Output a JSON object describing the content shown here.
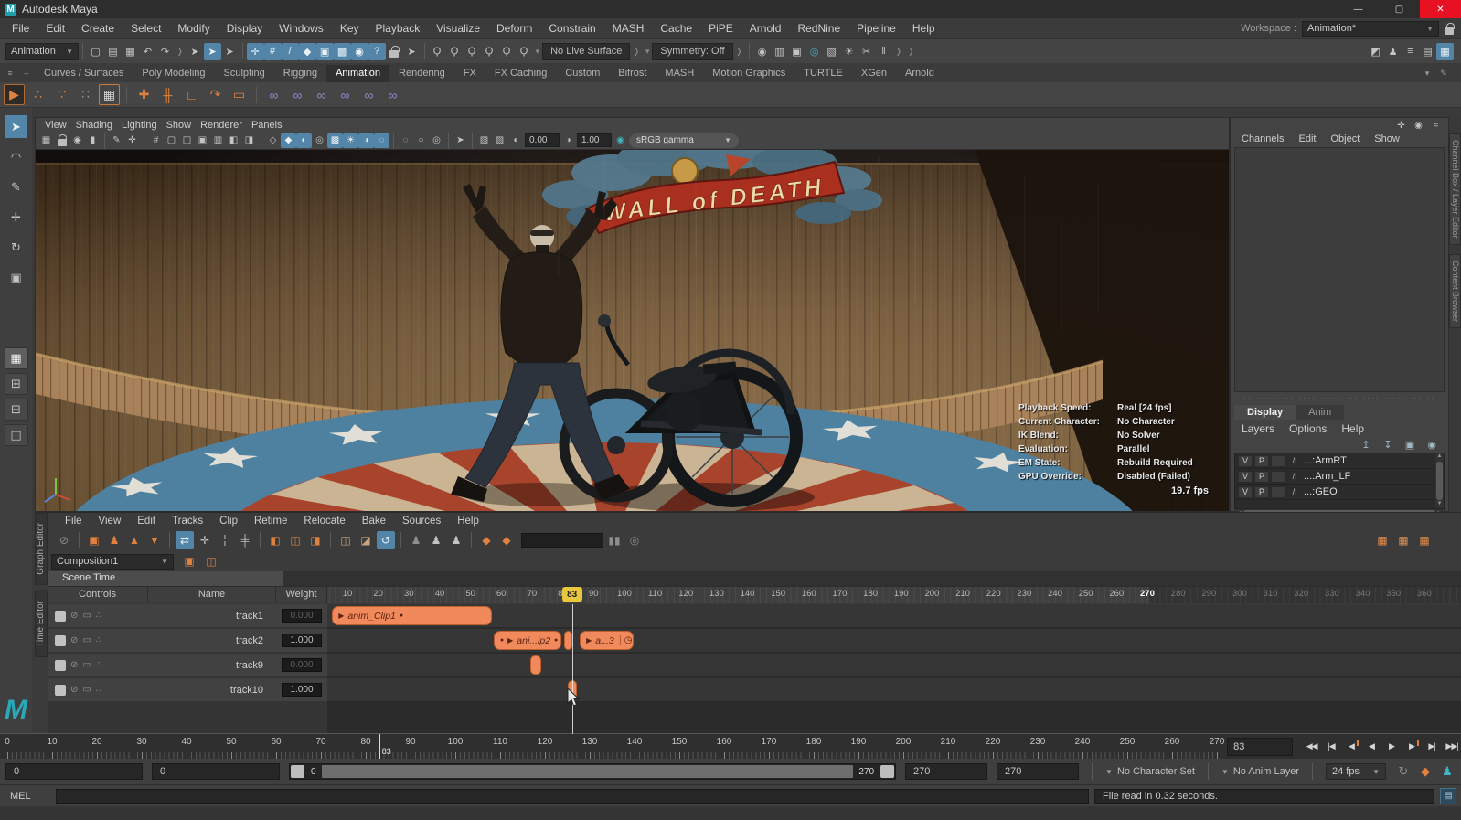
{
  "titlebar": {
    "title": "Autodesk Maya"
  },
  "menubar": {
    "items": [
      "File",
      "Edit",
      "Create",
      "Select",
      "Modify",
      "Display",
      "Windows",
      "Key",
      "Playback",
      "Visualize",
      "Deform",
      "Constrain",
      "MASH",
      "Cache",
      "PiPE",
      "Arnold",
      "RedNine",
      "Pipeline",
      "Help"
    ],
    "workspace_label": "Workspace :",
    "workspace_value": "Animation*"
  },
  "toolbar": {
    "menu_set": "Animation",
    "no_live_surface": "No Live Surface",
    "symmetry": "Symmetry: Off",
    "file_icons": [
      [
        "new-scene-icon",
        "▢"
      ],
      [
        "open-scene-icon",
        "▤"
      ],
      [
        "save-scene-icon",
        "▦"
      ],
      [
        "undo-icon",
        "↶"
      ],
      [
        "redo-icon",
        "↷"
      ]
    ],
    "select_icons": [
      [
        "select-by-hierarchy-icon",
        "➤"
      ],
      [
        "select-by-object-icon",
        "➤",
        "active"
      ],
      [
        "select-by-component-icon",
        "➤"
      ]
    ],
    "snap_icons": [
      [
        "move-snap-icon",
        "✛",
        "blue"
      ],
      [
        "snap-to-grids-icon",
        "#",
        "blue"
      ],
      [
        "snap-to-curves-icon",
        "/",
        "blue"
      ],
      [
        "snap-to-points-icon",
        "◆",
        "blue"
      ],
      [
        "snap-to-projected-center-icon",
        "▣",
        "blue"
      ],
      [
        "snap-to-view-planes-icon",
        "▩",
        "blue"
      ],
      [
        "make-live-icon",
        "◉",
        "blue"
      ],
      [
        "snap-together-icon",
        "?",
        "blue"
      ]
    ],
    "lock_icons": [
      [
        "lock-selection-icon",
        "LOCK"
      ],
      [
        "highlight-selection-icon",
        "➤"
      ]
    ],
    "history_icons": [
      [
        "input-connections-icon",
        "Ϙ"
      ],
      [
        "output-connections-icon",
        "Ϙ"
      ],
      [
        "construction-history-icon",
        "Ϙ"
      ],
      [
        "input-line-icon",
        "Ϙ"
      ],
      [
        "select-input-icon",
        "Ϙ"
      ],
      [
        "operations-list-icon",
        "Ϙ"
      ]
    ],
    "render_icons": [
      [
        "render-view-icon",
        "◉"
      ],
      [
        "playblast-icon",
        "▥"
      ],
      [
        "ipr-render-icon",
        "▣"
      ],
      [
        "render-settings-icon",
        "◎",
        "teal"
      ],
      [
        "hypershade-icon",
        "▧"
      ],
      [
        "light-editor-icon",
        "☀"
      ],
      [
        "cut-icon",
        "✂"
      ],
      [
        "pause-viewport-icon",
        "‖"
      ]
    ],
    "right_icons": [
      [
        "modeling-toolkit-icon",
        "◩"
      ],
      [
        "character-controls-icon",
        "♟"
      ],
      [
        "channel-box-toggle-icon",
        "≡"
      ],
      [
        "attribute-editor-toggle-icon",
        "▤"
      ],
      [
        "tool-settings-toggle-icon",
        "▦",
        "active"
      ]
    ]
  },
  "shelf": {
    "tabs": [
      "Curves / Surfaces",
      "Poly Modeling",
      "Sculpting",
      "Rigging",
      "Animation",
      "Rendering",
      "FX",
      "FX Caching",
      "Custom",
      "Bifrost",
      "MASH",
      "Motion Graphics",
      "TURTLE",
      "XGen",
      "Arnold"
    ],
    "active_tab": "Animation",
    "icons": [
      [
        "playblast-shelf-icon",
        "▶",
        "boxed"
      ],
      [
        "motion-trail-icon",
        "∴",
        "orange"
      ],
      [
        "ghost-icon",
        "∵",
        "orange"
      ],
      [
        "unghost-icon",
        "∷",
        "ghost"
      ],
      [
        "graph-editor-shelf-icon",
        "▦",
        "oframe"
      ],
      [
        "sep"
      ],
      [
        "set-key-icon",
        "✚",
        "okey"
      ],
      [
        "hold-current-keys-icon",
        "╫",
        "okey"
      ],
      [
        "set-breakdown-icon",
        "∟",
        "okey"
      ],
      [
        "set-driven-key-icon",
        "↷",
        "okey"
      ],
      [
        "buffer-curve-icon",
        "▭",
        "okey"
      ],
      [
        "sep"
      ],
      [
        "parent-constraint-icon",
        "∞",
        "purple"
      ],
      [
        "point-constraint-icon",
        "∞",
        "purple"
      ],
      [
        "orient-constraint-icon",
        "∞",
        "purple"
      ],
      [
        "scale-constraint-icon",
        "∞",
        "purple"
      ],
      [
        "aim-constraint-icon",
        "∞",
        "purple"
      ],
      [
        "pole-vector-constraint-icon",
        "∞",
        "purple"
      ]
    ]
  },
  "toolbox": {
    "tools": [
      [
        "select-tool-icon",
        "➤",
        "active"
      ],
      [
        "lasso-tool-icon",
        "◠"
      ],
      [
        "paint-select-tool-icon",
        "✎"
      ],
      [
        "move-tool-icon",
        "✛"
      ],
      [
        "rotate-tool-icon",
        "↻"
      ],
      [
        "scale-tool-icon",
        "▣"
      ]
    ],
    "layouts": [
      [
        "single-pane-layout-button",
        "▦",
        "active"
      ],
      [
        "four-pane-layout-button",
        "⊞"
      ],
      [
        "two-pane-layout-button",
        "⊟"
      ],
      [
        "persp-outliner-layout-button",
        "◫"
      ]
    ]
  },
  "viewport": {
    "menus": [
      "View",
      "Shading",
      "Lighting",
      "Show",
      "Renderer",
      "Panels"
    ],
    "bar_icons": [
      [
        "select-camera-icon",
        "▦"
      ],
      [
        "lock-camera-icon",
        "LOCK"
      ],
      [
        "camera-attributes-icon",
        "◉"
      ],
      [
        "bookmark-icon",
        "▮"
      ],
      [
        "sep"
      ],
      [
        "image-plane-icon",
        "✎"
      ],
      [
        "pan-zoom-icon",
        "✛"
      ],
      [
        "sep"
      ],
      [
        "grid-icon",
        "#"
      ],
      [
        "film-gate-icon",
        "▢"
      ],
      [
        "resolution-gate-icon",
        "◫"
      ],
      [
        "gate-mask-icon",
        "▣"
      ],
      [
        "field-chart-icon",
        "▥"
      ],
      [
        "safe-action-icon",
        "◧"
      ],
      [
        "safe-title-icon",
        "◨"
      ],
      [
        "sep"
      ],
      [
        "wireframe-icon",
        "◇"
      ],
      [
        "shaded-icon",
        "◆",
        "active"
      ],
      [
        "textured-icon",
        "◐",
        "active"
      ],
      [
        "use-default-material-icon",
        "◎"
      ],
      [
        "wireframe-on-shaded-icon",
        "▩",
        "active"
      ],
      [
        "lighting-icon",
        "☀",
        "active"
      ],
      [
        "shadows-icon",
        "◑",
        "active"
      ],
      [
        "occlusion-icon",
        "◌",
        "active"
      ],
      [
        "sep"
      ],
      [
        "motion-blur-icon",
        "◌"
      ],
      [
        "multisample-icon",
        "○"
      ],
      [
        "depth-of-field-icon",
        "◎"
      ],
      [
        "sep"
      ],
      [
        "isolate-select-icon",
        "➤"
      ],
      [
        "sep"
      ],
      [
        "xray-icon",
        "▧"
      ],
      [
        "xray-joints-icon",
        "▨"
      ]
    ],
    "exposure_icon": "◐",
    "exposure": "0.00",
    "gamma_icon": "◑",
    "gamma": "1.00",
    "color-management-icon": "◉",
    "view_transform": "sRGB gamma",
    "banner_text": "WALL of DEATH",
    "hud": {
      "rows": [
        {
          "label": "Playback Speed:",
          "value": "Real [24 fps]"
        },
        {
          "label": "Current Character:",
          "value": "No Character"
        },
        {
          "label": "IK Blend:",
          "value": "No Solver"
        },
        {
          "label": "Evaluation:",
          "value": "Parallel"
        },
        {
          "label": "EM State:",
          "value": "Rebuild Required"
        },
        {
          "label": "GPU Override:",
          "value": "Disabled (Failed)"
        }
      ],
      "fps": "19.7 fps"
    }
  },
  "right_panel": {
    "top_icons": [
      [
        "channel-manipulator-icon",
        "✛"
      ],
      [
        "channel-speed-icon",
        "◉"
      ],
      [
        "channel-graph-icon",
        "≈"
      ]
    ],
    "menus": [
      "Channels",
      "Edit",
      "Object",
      "Show"
    ],
    "side_tabs": [
      "Channel Box / Layer Editor",
      "Content Browser"
    ],
    "layer_editor": {
      "tabs": [
        "Display",
        "Anim"
      ],
      "active_tab": "Display",
      "menus": [
        "Layers",
        "Options",
        "Help"
      ],
      "toolbar_icons": [
        [
          "move-layer-up-icon",
          "↥"
        ],
        [
          "move-layer-down-icon",
          "↧"
        ],
        [
          "new-empty-layer-icon",
          "▣"
        ],
        [
          "new-layer-from-selected-icon",
          "◉"
        ]
      ],
      "layers": [
        {
          "visibility": "V",
          "playback": "P",
          "type": "/|",
          "name": "...:ArmRT"
        },
        {
          "visibility": "V",
          "playback": "P",
          "type": "/|",
          "name": "...:Arm_LF"
        },
        {
          "visibility": "V",
          "playback": "P",
          "type": "/|",
          "name": "...:GEO"
        }
      ]
    }
  },
  "time_editor": {
    "side_tabs": [
      "Graph Editor",
      "Time Editor"
    ],
    "menus": [
      "File",
      "View",
      "Edit",
      "Tracks",
      "Clip",
      "Retime",
      "Relocate",
      "Bake",
      "Sources",
      "Help"
    ],
    "toolbar_icons": [
      [
        "mute-track-icon",
        "⊘",
        "ghost"
      ],
      [
        "sep"
      ],
      [
        "add-clip-icon",
        "▣",
        "orange"
      ],
      [
        "add-relocator-icon",
        "♟",
        "orange"
      ],
      [
        "export-clips-icon",
        "▲",
        "orange"
      ],
      [
        "import-clips-icon",
        "▼",
        "orange"
      ],
      [
        "sep"
      ],
      [
        "ripple-edit-icon",
        "⇄",
        "active"
      ],
      [
        "move-clips-icon",
        "✛"
      ],
      [
        "razor-clip-icon",
        "╎"
      ],
      [
        "snap-clips-icon",
        "╪"
      ],
      [
        "sep"
      ],
      [
        "trim-clip-start-icon",
        "◧",
        "orange"
      ],
      [
        "trim-clip-icon",
        "◫",
        "orange"
      ],
      [
        "trim-clip-end-icon",
        "◨",
        "orange"
      ],
      [
        "sep"
      ],
      [
        "loop-clip-icon",
        "◫",
        "halforange"
      ],
      [
        "hold-clip-icon",
        "◪",
        "halforange"
      ],
      [
        "ease-curve-icon",
        "↺",
        "active"
      ],
      [
        "sep"
      ],
      [
        "bake-character-icon",
        "♟",
        "ghost"
      ],
      [
        "add-character-icon",
        "♟"
      ],
      [
        "remove-character-icon",
        "♟"
      ],
      [
        "sep"
      ],
      [
        "add-key-icon",
        "◆",
        "orange"
      ],
      [
        "add-key-at-current-icon",
        "◆",
        "orange"
      ]
    ],
    "toolbar_right_icons": [
      [
        "grid-view-icon",
        "▦"
      ],
      [
        "sheet-view-icon",
        "▦"
      ],
      [
        "stack-view-icon",
        "▦"
      ]
    ],
    "composition": "Composition1",
    "comp_icons": [
      [
        "new-composition-icon",
        "▣",
        "orange"
      ],
      [
        "duplicate-composition-icon",
        "◫",
        "orange"
      ]
    ],
    "scene_tab": "Scene Time",
    "columns": [
      "Controls",
      "Name",
      "Weight"
    ],
    "tracks": [
      {
        "name": "track1",
        "weight": "0.000",
        "weight_active": false
      },
      {
        "name": "track2",
        "weight": "1.000",
        "weight_active": true
      },
      {
        "name": "track9",
        "weight": "0.000",
        "weight_active": false
      },
      {
        "name": "track10",
        "weight": "1.000",
        "weight_active": true
      }
    ],
    "clips": [
      {
        "track": 0,
        "label": "anim_Clip1",
        "start": 5,
        "end": 57,
        "style": "bar",
        "left_dot": false,
        "right_dot": true,
        "play": true,
        "clock": false
      },
      {
        "track": 1,
        "label": "ani...ip2",
        "start": 57.5,
        "end": 79.5,
        "style": "bar",
        "left_dot": true,
        "right_dot": true,
        "play": true,
        "clock": false
      },
      {
        "track": 1,
        "label": "",
        "start": 80.5,
        "end": 83,
        "style": "nub"
      },
      {
        "track": 1,
        "label": "a...3",
        "start": 85.5,
        "end": 103,
        "style": "bar",
        "left_dot": false,
        "right_dot": false,
        "play": true,
        "clock": true
      },
      {
        "track": 2,
        "label": "",
        "start": 69.5,
        "end": 73,
        "style": "nub"
      },
      {
        "track": 3,
        "label": "",
        "start": 81.5,
        "end": 84.5,
        "style": "nub"
      }
    ],
    "ruler": {
      "start": 10,
      "end": 360,
      "step": 10,
      "active_end": 270
    },
    "playhead_frame": 83,
    "playhead_label": "83"
  },
  "time_slider": {
    "start": 0,
    "end": 270,
    "step": 10,
    "current_frame": 83,
    "current_label": "83",
    "frame_field": "83",
    "playback_buttons": [
      [
        "go-to-start-button",
        "|◀◀"
      ],
      [
        "step-back-frame-button",
        "|◀"
      ],
      [
        "step-back-key-button",
        "◀",
        "key"
      ],
      [
        "play-backwards-button",
        "◀"
      ],
      [
        "play-forwards-button",
        "▶"
      ],
      [
        "step-forward-key-button",
        "▶",
        "key"
      ],
      [
        "step-forward-frame-button",
        "▶|"
      ],
      [
        "go-to-end-button",
        "▶▶|"
      ]
    ]
  },
  "range_slider": {
    "anim_start": "0",
    "play_start": "0",
    "bar_start": "0",
    "bar_end": "270",
    "play_end": "270",
    "anim_end": "270",
    "character_set": "No Character Set",
    "anim_layer": "No Anim Layer",
    "fps": "24 fps",
    "icons": [
      [
        "loop-playback-icon",
        "↻",
        "ghost"
      ],
      [
        "auto-key-icon",
        "◆",
        "orange"
      ],
      [
        "anim-preferences-icon",
        "♟",
        "teal"
      ]
    ]
  },
  "status_bar": {
    "mode": "MEL",
    "message": "File read in  0.32 seconds."
  }
}
